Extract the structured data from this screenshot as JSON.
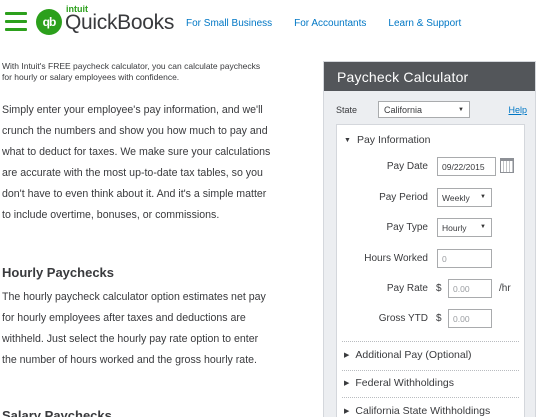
{
  "header": {
    "logo_intuit": "intuit",
    "logo_badge": "qb",
    "logo_text": "QuickBooks",
    "nav": [
      "For Small Business",
      "For Accountants",
      "Learn & Support"
    ]
  },
  "content": {
    "intro": "With Intuit's FREE paycheck calculator, you can calculate paychecks for hourly or salary employees with confidence.",
    "paragraph1": "Simply enter your employee's pay information, and we'll crunch the numbers and show you how much to pay and what to deduct for taxes. We make sure your calculations are accurate with the most up-to-date tax tables, so you don't have to even think about it. And it's a simple matter to include overtime, bonuses, or commissions.",
    "heading_hourly": "Hourly Paychecks",
    "paragraph2": "The hourly paycheck calculator option estimates net pay for hourly employees after taxes and deductions are withheld. Just select the hourly pay rate option to enter the number of hours worked and the gross hourly rate.",
    "heading_salary": "Salary Paychecks"
  },
  "calculator": {
    "title": "Paycheck Calculator",
    "state_label": "State",
    "state_value": "California",
    "help_label": "Help",
    "sections": {
      "pay_information": "Pay Information",
      "additional_pay": "Additional Pay (Optional)",
      "federal": "Federal Withholdings",
      "california": "California State Withholdings"
    },
    "fields": {
      "pay_date_label": "Pay Date",
      "pay_date_value": "09/22/2015",
      "pay_period_label": "Pay Period",
      "pay_period_value": "Weekly",
      "pay_type_label": "Pay Type",
      "pay_type_value": "Hourly",
      "hours_label": "Hours Worked",
      "hours_placeholder": "0",
      "pay_rate_label": "Pay Rate",
      "pay_rate_placeholder": "0.00",
      "pay_rate_unit": "/hr",
      "gross_ytd_label": "Gross YTD",
      "gross_ytd_placeholder": "0.00",
      "currency": "$"
    }
  },
  "colors": {
    "brand_green": "#2ca01c",
    "link_blue": "#0077c5",
    "calc_header": "#53565a"
  },
  "icons": [
    "hamburger-menu-icon",
    "calendar-icon",
    "caret-down-icon",
    "triangle-right-icon",
    "triangle-down-icon"
  ]
}
